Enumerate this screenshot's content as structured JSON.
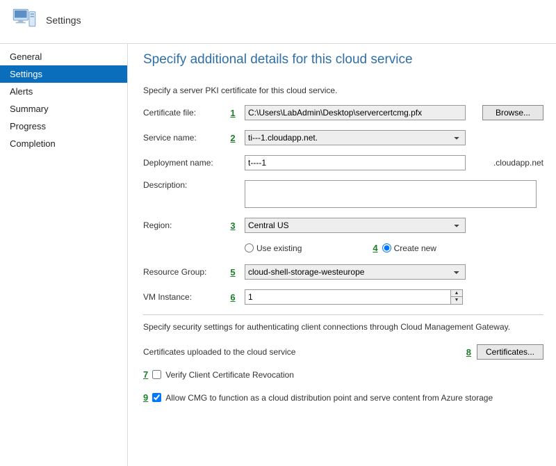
{
  "header": {
    "title": "Settings"
  },
  "sidebar": {
    "items": [
      {
        "label": "General"
      },
      {
        "label": "Settings"
      },
      {
        "label": "Alerts"
      },
      {
        "label": "Summary"
      },
      {
        "label": "Progress"
      },
      {
        "label": "Completion"
      }
    ]
  },
  "main": {
    "title": "Specify additional details for this cloud service",
    "pki_text": "Specify a server PKI certificate for this cloud service.",
    "cert_file_label": "Certificate file:",
    "cert_file_value": "C:\\Users\\LabAdmin\\Desktop\\servercertcmg.pfx",
    "browse_label": "Browse...",
    "service_name_label": "Service name:",
    "service_name_value": "ti---1.cloudapp.net.",
    "deployment_label": "Deployment name:",
    "deployment_value": "t----1",
    "deployment_suffix": ".cloudapp.net",
    "description_label": "Description:",
    "description_value": "",
    "region_label": "Region:",
    "region_value": "Central US",
    "use_existing_label": "Use existing",
    "create_new_label": "Create new",
    "resource_group_label": "Resource Group:",
    "resource_group_value": "cloud-shell-storage-westeurope",
    "vm_instance_label": "VM Instance:",
    "vm_instance_value": "1",
    "security_text": "Specify security settings for authenticating client connections through Cloud Management Gateway.",
    "certs_uploaded_label": "Certificates uploaded to the cloud service",
    "certificates_btn": "Certificates...",
    "verify_revocation_label": "Verify Client Certificate Revocation",
    "allow_cmg_label": "Allow CMG to function as a cloud distribution point and serve content from Azure storage"
  },
  "annotations": {
    "a1": "1",
    "a2": "2",
    "a3": "3",
    "a4": "4",
    "a5": "5",
    "a6": "6",
    "a7": "7",
    "a8": "8",
    "a9": "9"
  }
}
